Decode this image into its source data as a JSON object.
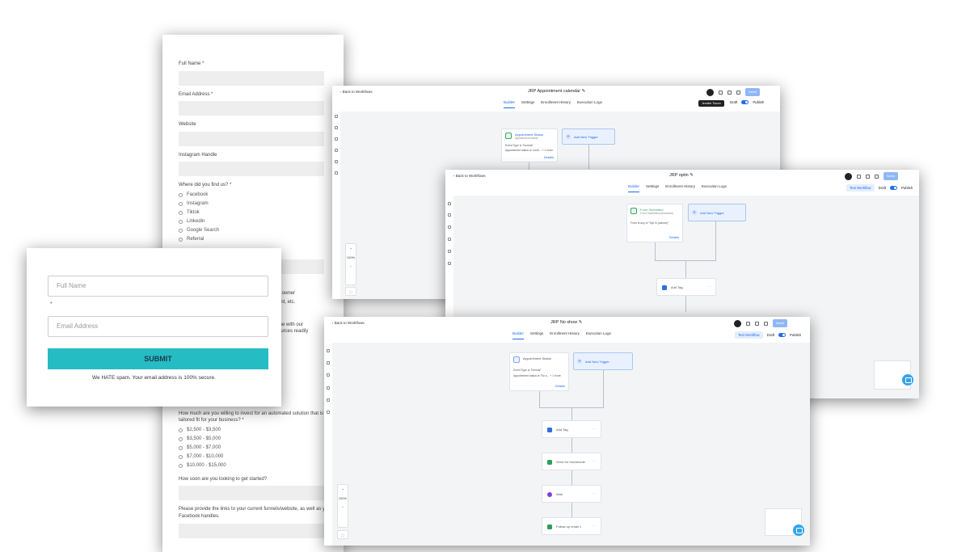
{
  "long_form": {
    "full_name_label": "Full Name *",
    "email_label": "Email Address *",
    "website_label": "Website",
    "instagram_label": "Instagram Handle",
    "where_label": "Where did you find us? *",
    "where_options": [
      "Facebook",
      "Instagram",
      "Tiktok",
      "Linkedin",
      "Google Search",
      "Referral"
    ],
    "partial_text_1": "s owner",
    "partial_text_2": "ont, etc.",
    "partial_text_3": "me with our",
    "partial_text_4": "ources readily",
    "invest_label_line1": "How much are you willing to invest for an automated solution that is",
    "invest_label_line2": "tailored fit for your business? *",
    "invest_options": [
      "$2,500 - $3,500",
      "$3,500 - $5,000",
      "$5,000 - $7,000",
      "$7,000 - $10,000",
      "$10,000 - $15,000"
    ],
    "soon_label": "How soon are you looking to get started?",
    "links_label_line1": "Please provide the links to your current funnels/website, as well as your",
    "links_label_line2": "Facebook handles."
  },
  "optin": {
    "full_name_placeholder": "Full Name",
    "email_placeholder": "Email Address",
    "asterisk": "*",
    "submit_label": "SUBMIT",
    "note": "We HATE spam. Your email address is 100% secure."
  },
  "workflow_common": {
    "back_label": "Back to Workflows",
    "tabs": [
      "Builder",
      "Settings",
      "Enrollment History",
      "Execution Logs"
    ],
    "test_label": "Test Workflow",
    "draft_label": "Draft",
    "publish_label": "Publish",
    "save_label": "Saved",
    "add_trigger_label": "Add New Trigger",
    "details_label": "Details",
    "zoom_level": "100%",
    "zoom_in": "+",
    "zoom_out": "−",
    "fit_icon": "⛶"
  },
  "wf1": {
    "title": "JRP Appointment calendar",
    "tooltip": "Jennifer Tiazon",
    "trigger_title": "Appointment Status",
    "trigger_sub": "Appointment status",
    "trigger_line1": "Event Type is \"Normal\"",
    "trigger_line2": "Appointment status is \"confi...  + 1 more"
  },
  "wf2": {
    "title": "JRP optin",
    "trigger_title": "Form Submitted",
    "trigger_sub": "Form Submitted (sehoedue)",
    "trigger_line1": "Form is any of \"Opt in (carbon)\"",
    "action_label": "Add Tag"
  },
  "wf3": {
    "title": "JRP No show",
    "trigger_title": "Appointment Status",
    "trigger_line1": "Event Type is \"Normal\"",
    "trigger_line2": "Appointment status is \"No s...  + 1 more",
    "actions": [
      "Add Tag",
      "Send for reschedule",
      "Wait",
      "Follow up email 1"
    ]
  },
  "colors": {
    "accent": "#1e6ee8",
    "submit": "#26bcc4",
    "canvas": "#f3f4f6"
  },
  "icons": [
    "back-arrow-icon",
    "pencil-icon",
    "undo-icon",
    "redo-icon",
    "tag-icon",
    "mail-icon",
    "clock-icon",
    "chat-icon"
  ]
}
